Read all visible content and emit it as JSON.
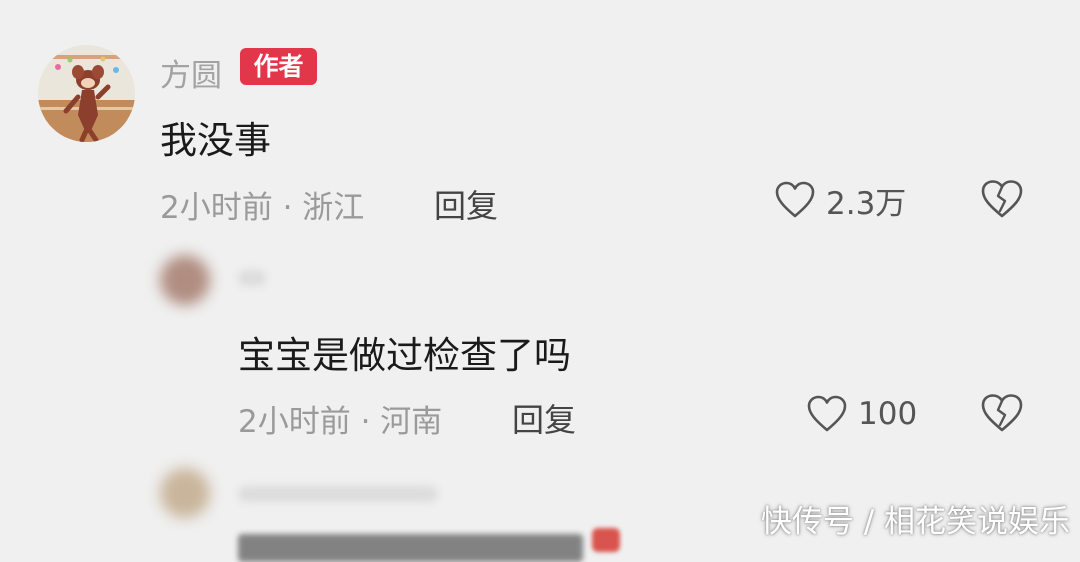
{
  "comments": [
    {
      "username": "方圆",
      "badge": "作者",
      "text": "我没事",
      "meta": "2小时前 · 浙江",
      "reply_label": "回复",
      "likes": "2.3万",
      "avatar_icon": "cartoon-avatar",
      "like_icon": "heart-outline-icon",
      "dislike_icon": "broken-heart-icon"
    },
    {
      "text": "宝宝是做过检查了吗",
      "meta": "2小时前 · 河南",
      "reply_label": "回复",
      "likes": "100",
      "avatar_icon": "blurred-avatar",
      "like_icon": "heart-outline-icon",
      "dislike_icon": "broken-heart-icon"
    },
    {
      "avatar_icon": "blurred-avatar"
    }
  ],
  "watermark": "快传号 / 相花笑说娱乐",
  "colors": {
    "background": "#f0f0f0",
    "badge": "#e2364a",
    "meta_text": "#9a9a9a"
  }
}
